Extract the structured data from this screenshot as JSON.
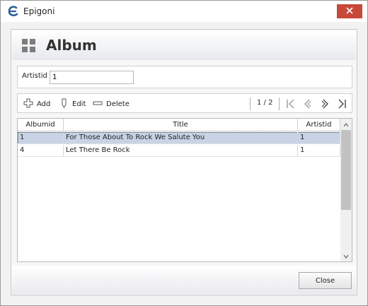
{
  "window": {
    "title": "Epigoni",
    "app_icon": "epigoni-logo-icon",
    "close_icon": "close-icon",
    "close_color": "#c7493a"
  },
  "header": {
    "icon": "grid-icon",
    "title": "Album"
  },
  "filter": {
    "label": "Artistid",
    "value": "1"
  },
  "toolbar": {
    "add_label": "Add",
    "edit_label": "Edit",
    "delete_label": "Delete",
    "pager_text": "1 / 2",
    "icons": [
      "add-icon",
      "edit-icon",
      "delete-icon",
      "first-page-icon",
      "previous-page-icon",
      "next-page-icon",
      "last-page-icon"
    ]
  },
  "table": {
    "columns": [
      "Albumid",
      "Title",
      "Artistid"
    ],
    "rows": [
      [
        "1",
        "For Those About To Rock We Salute You",
        "1"
      ],
      [
        "4",
        "Let There Be Rock",
        "1"
      ]
    ],
    "selected_row": 0,
    "selection_color": "#c8d3e6"
  },
  "footer": {
    "close_label": "Close"
  }
}
